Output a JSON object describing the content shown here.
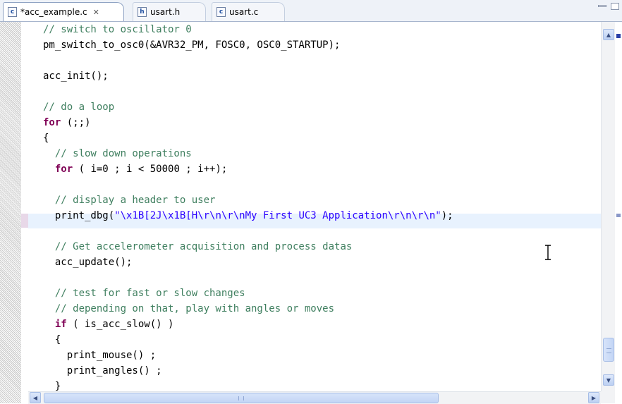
{
  "tabs": [
    {
      "label": "*acc_example.c",
      "icon": "c-source-file-icon",
      "icon_glyph": "c",
      "close": "✕",
      "active": true
    },
    {
      "label": "usart.h",
      "icon": "h-header-file-icon",
      "icon_glyph": "h",
      "active": false
    },
    {
      "label": "usart.c",
      "icon": "c-source-file-icon",
      "icon_glyph": "c",
      "active": false
    }
  ],
  "code_lines": [
    [
      {
        "t": "cm",
        "v": "// switch to oscillator 0"
      }
    ],
    [
      {
        "t": "",
        "v": "pm_switch_to_osc0(&AVR32_PM, FOSC0, OSC0_STARTUP);"
      }
    ],
    [],
    [
      {
        "t": "",
        "v": "acc_init();"
      }
    ],
    [],
    [
      {
        "t": "cm",
        "v": "// do a loop"
      }
    ],
    [
      {
        "t": "kw",
        "v": "for"
      },
      {
        "t": "",
        "v": " (;;)"
      }
    ],
    [
      {
        "t": "",
        "v": "{"
      }
    ],
    [
      {
        "t": "",
        "v": "  "
      },
      {
        "t": "cm",
        "v": "// slow down operations"
      }
    ],
    [
      {
        "t": "",
        "v": "  "
      },
      {
        "t": "kw",
        "v": "for"
      },
      {
        "t": "",
        "v": " ( i=0 ; i < 50000 ; i++);"
      }
    ],
    [],
    [
      {
        "t": "",
        "v": "  "
      },
      {
        "t": "cm",
        "v": "// display a header to user"
      }
    ],
    [
      {
        "t": "",
        "v": "  print_dbg("
      },
      {
        "t": "str",
        "v": "\"\\x1B[2J\\x1B[H\\r\\n\\r\\nMy First UC3 Application\\r\\n\\r\\n\""
      },
      {
        "t": "",
        "v": ");"
      }
    ],
    [],
    [
      {
        "t": "",
        "v": "  "
      },
      {
        "t": "cm",
        "v": "// Get accelerometer acquisition and process datas"
      }
    ],
    [
      {
        "t": "",
        "v": "  acc_update();"
      }
    ],
    [],
    [
      {
        "t": "",
        "v": "  "
      },
      {
        "t": "cm",
        "v": "// test for fast or slow changes"
      }
    ],
    [
      {
        "t": "",
        "v": "  "
      },
      {
        "t": "cm",
        "v": "// depending on that, play with angles or moves"
      }
    ],
    [
      {
        "t": "",
        "v": "  "
      },
      {
        "t": "kw",
        "v": "if"
      },
      {
        "t": "",
        "v": " ( is_acc_slow() )"
      }
    ],
    [
      {
        "t": "",
        "v": "  {"
      }
    ],
    [
      {
        "t": "",
        "v": "    print_mouse() ;"
      }
    ],
    [
      {
        "t": "",
        "v": "    print_angles() ;"
      }
    ],
    [
      {
        "t": "",
        "v": "  }"
      }
    ]
  ],
  "current_line_index": 12,
  "scrollbar": {
    "up_arrow": "▲",
    "down_arrow": "▼",
    "left_arrow": "◀",
    "right_arrow": "▶"
  },
  "colors": {
    "comment": "#3f7f5f",
    "keyword": "#7f0055",
    "string": "#2a00ff",
    "current_line": "#e8f2fe"
  }
}
